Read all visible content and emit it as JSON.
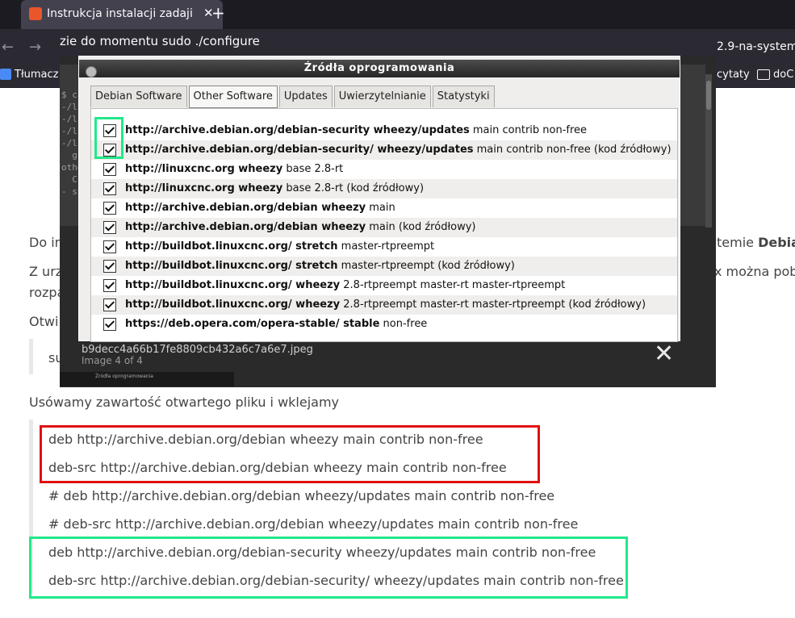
{
  "browser": {
    "tab_title": "Instrukcja instalacji zadaji",
    "tab_close": "✕",
    "new_tab": "+",
    "url_left": "zie do momentu sudo ./configure",
    "url_right": "2.9-na-system",
    "bookmarks": {
      "translate": "Tłumacz",
      "cytaty": "cytaty",
      "doc": "doC"
    }
  },
  "page": {
    "line_do": "Do in",
    "line_do_right": "temie",
    "line_do_right_bold": "Debia",
    "line_z": "Z urz",
    "line_z_right": "x można pob",
    "line_rozpa": "rozpa",
    "line_otwi": "Otwi",
    "line_su": "su",
    "usuwamy": "Usówamy zawartość otwartego pliku i wklejamy",
    "code_lines": [
      "deb http://archive.debian.org/debian wheezy main contrib non-free",
      "deb-src http://archive.debian.org/debian wheezy main contrib non-free",
      "# deb http://archive.debian.org/debian wheezy/updates main contrib non-free",
      "# deb-src http://archive.debian.org/debian wheezy/updates main contrib non-free",
      "deb http://archive.debian.org/debian-security wheezy/updates main contrib non-free",
      "deb-src http://archive.debian.org/debian-security/ wheezy/updates main contrib non-free"
    ]
  },
  "lightbox": {
    "filename": "b9decc4a66b17fe8809cb432a6c7a6e7.jpeg",
    "counter": "Image 4 of 4",
    "close": "✕",
    "thumb_caption": "Źródła oprogramowania",
    "terminal_text": "$ c\n-/li\n-/li\n-/li\n-/li\n  g-\nother\n  C-\n- su"
  },
  "dialog": {
    "title": "Źródła oprogramowania",
    "tabs": [
      "Debian Software",
      "Other Software",
      "Updates",
      "Uwierzytelnianie",
      "Statystyki"
    ],
    "active_tab": "Other Software",
    "repos": [
      {
        "url": "http://archive.debian.org/debian-security wheezy/updates",
        "rest": " main contrib non-free"
      },
      {
        "url": "http://archive.debian.org/debian-security/ wheezy/updates",
        "rest": " main contrib non-free (kod źródłowy)"
      },
      {
        "url": "http://linuxcnc.org wheezy",
        "rest": " base 2.8-rt"
      },
      {
        "url": "http://linuxcnc.org wheezy",
        "rest": " base 2.8-rt (kod źródłowy)"
      },
      {
        "url": "http://archive.debian.org/debian wheezy",
        "rest": " main"
      },
      {
        "url": "http://archive.debian.org/debian wheezy",
        "rest": " main (kod źródłowy)"
      },
      {
        "url": "http://buildbot.linuxcnc.org/ stretch",
        "rest": " master-rtpreempt"
      },
      {
        "url": "http://buildbot.linuxcnc.org/ stretch",
        "rest": " master-rtpreempt (kod źródłowy)"
      },
      {
        "url": "http://buildbot.linuxcnc.org/ wheezy",
        "rest": " 2.8-rtpreempt master-rt master-rtpreempt"
      },
      {
        "url": "http://buildbot.linuxcnc.org/ wheezy",
        "rest": " 2.8-rtpreempt master-rt master-rtpreempt (kod źródłowy)"
      },
      {
        "url": "https://deb.opera.com/opera-stable/ stable",
        "rest": " non-free"
      }
    ]
  }
}
